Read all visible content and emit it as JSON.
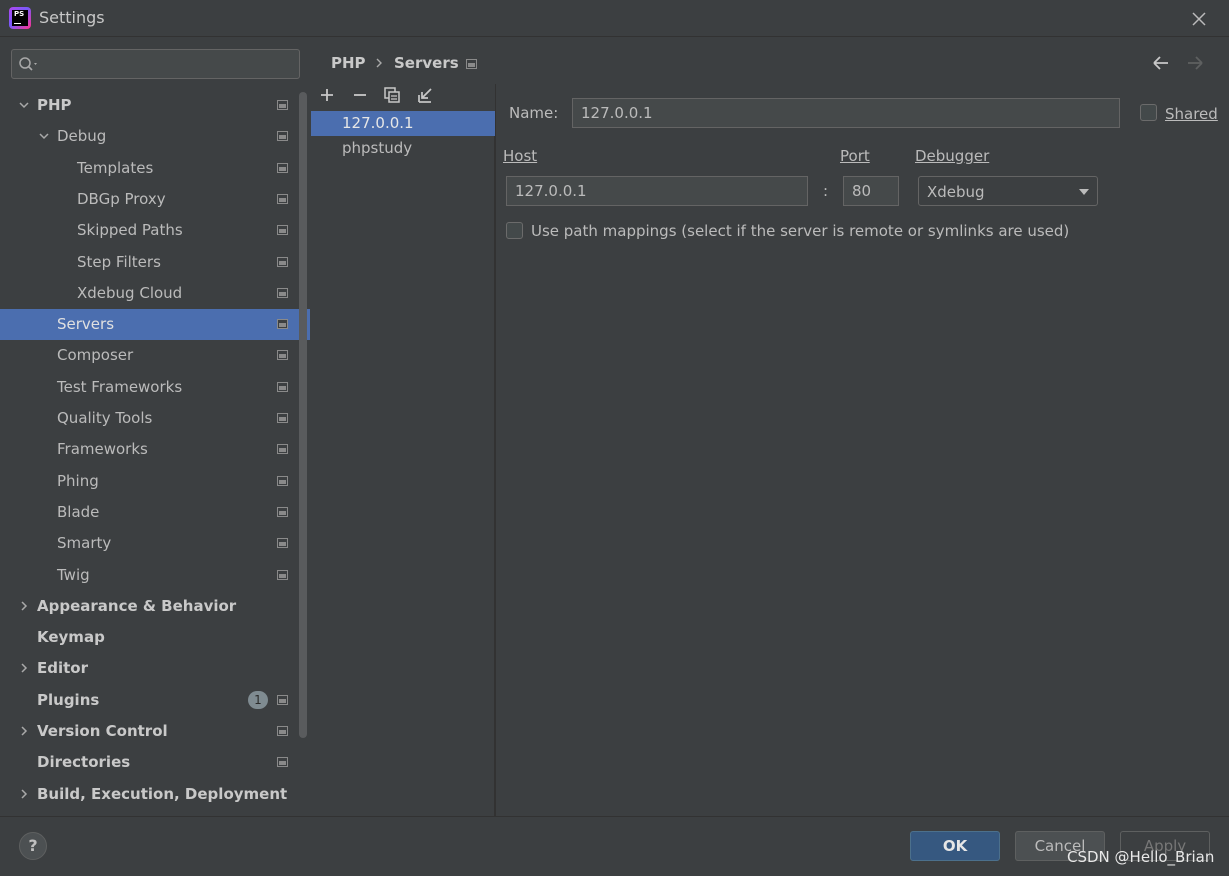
{
  "window": {
    "title": "Settings"
  },
  "search": {
    "placeholder": ""
  },
  "tree": {
    "items": [
      {
        "label": "PHP",
        "bold": true,
        "indent": 0,
        "expanded": true,
        "project_icon": true
      },
      {
        "label": "Debug",
        "bold": false,
        "indent": 1,
        "expanded": true,
        "project_icon": true
      },
      {
        "label": "Templates",
        "bold": false,
        "indent": 2,
        "project_icon": true
      },
      {
        "label": "DBGp Proxy",
        "bold": false,
        "indent": 2,
        "project_icon": true
      },
      {
        "label": "Skipped Paths",
        "bold": false,
        "indent": 2,
        "project_icon": true
      },
      {
        "label": "Step Filters",
        "bold": false,
        "indent": 2,
        "project_icon": true
      },
      {
        "label": "Xdebug Cloud",
        "bold": false,
        "indent": 2,
        "project_icon": true
      },
      {
        "label": "Servers",
        "bold": false,
        "indent": 1,
        "selected": true,
        "project_icon": true
      },
      {
        "label": "Composer",
        "bold": false,
        "indent": 1,
        "project_icon": true
      },
      {
        "label": "Test Frameworks",
        "bold": false,
        "indent": 1,
        "project_icon": true
      },
      {
        "label": "Quality Tools",
        "bold": false,
        "indent": 1,
        "project_icon": true
      },
      {
        "label": "Frameworks",
        "bold": false,
        "indent": 1,
        "project_icon": true
      },
      {
        "label": "Phing",
        "bold": false,
        "indent": 1,
        "project_icon": true
      },
      {
        "label": "Blade",
        "bold": false,
        "indent": 1,
        "project_icon": true
      },
      {
        "label": "Smarty",
        "bold": false,
        "indent": 1,
        "project_icon": true
      },
      {
        "label": "Twig",
        "bold": false,
        "indent": 1,
        "project_icon": true
      },
      {
        "label": "Appearance & Behavior",
        "bold": true,
        "indent": 0,
        "collapsed": true
      },
      {
        "label": "Keymap",
        "bold": true,
        "indent": 0
      },
      {
        "label": "Editor",
        "bold": true,
        "indent": 0,
        "collapsed": true
      },
      {
        "label": "Plugins",
        "bold": true,
        "indent": 0,
        "badge": "1",
        "project_icon": true
      },
      {
        "label": "Version Control",
        "bold": true,
        "indent": 0,
        "collapsed": true,
        "project_icon": true
      },
      {
        "label": "Directories",
        "bold": true,
        "indent": 0,
        "project_icon": true
      },
      {
        "label": "Build, Execution, Deployment",
        "bold": true,
        "indent": 0,
        "collapsed": true
      }
    ]
  },
  "breadcrumb": {
    "parent": "PHP",
    "current": "Servers"
  },
  "servers": {
    "items": [
      {
        "label": "127.0.0.1",
        "selected": true
      },
      {
        "label": "phpstudy",
        "selected": false
      }
    ]
  },
  "form": {
    "name_label": "Name:",
    "name_value": "127.0.0.1",
    "shared_label": "Shared",
    "host_label": "Host",
    "host_value": "127.0.0.1",
    "colon": ":",
    "port_label": "Port",
    "port_value": "80",
    "debugger_label": "Debugger",
    "debugger_value": "Xdebug",
    "path_mappings_label": "Use path mappings (select if the server is remote or symlinks are used)"
  },
  "buttons": {
    "help": "?",
    "ok": "OK",
    "cancel": "Cancel",
    "apply": "Apply"
  },
  "watermark": "CSDN @Hello_Brian",
  "colors": {
    "selection": "#4b6eaf",
    "ok_button": "#365880",
    "background": "#3c3f41"
  }
}
